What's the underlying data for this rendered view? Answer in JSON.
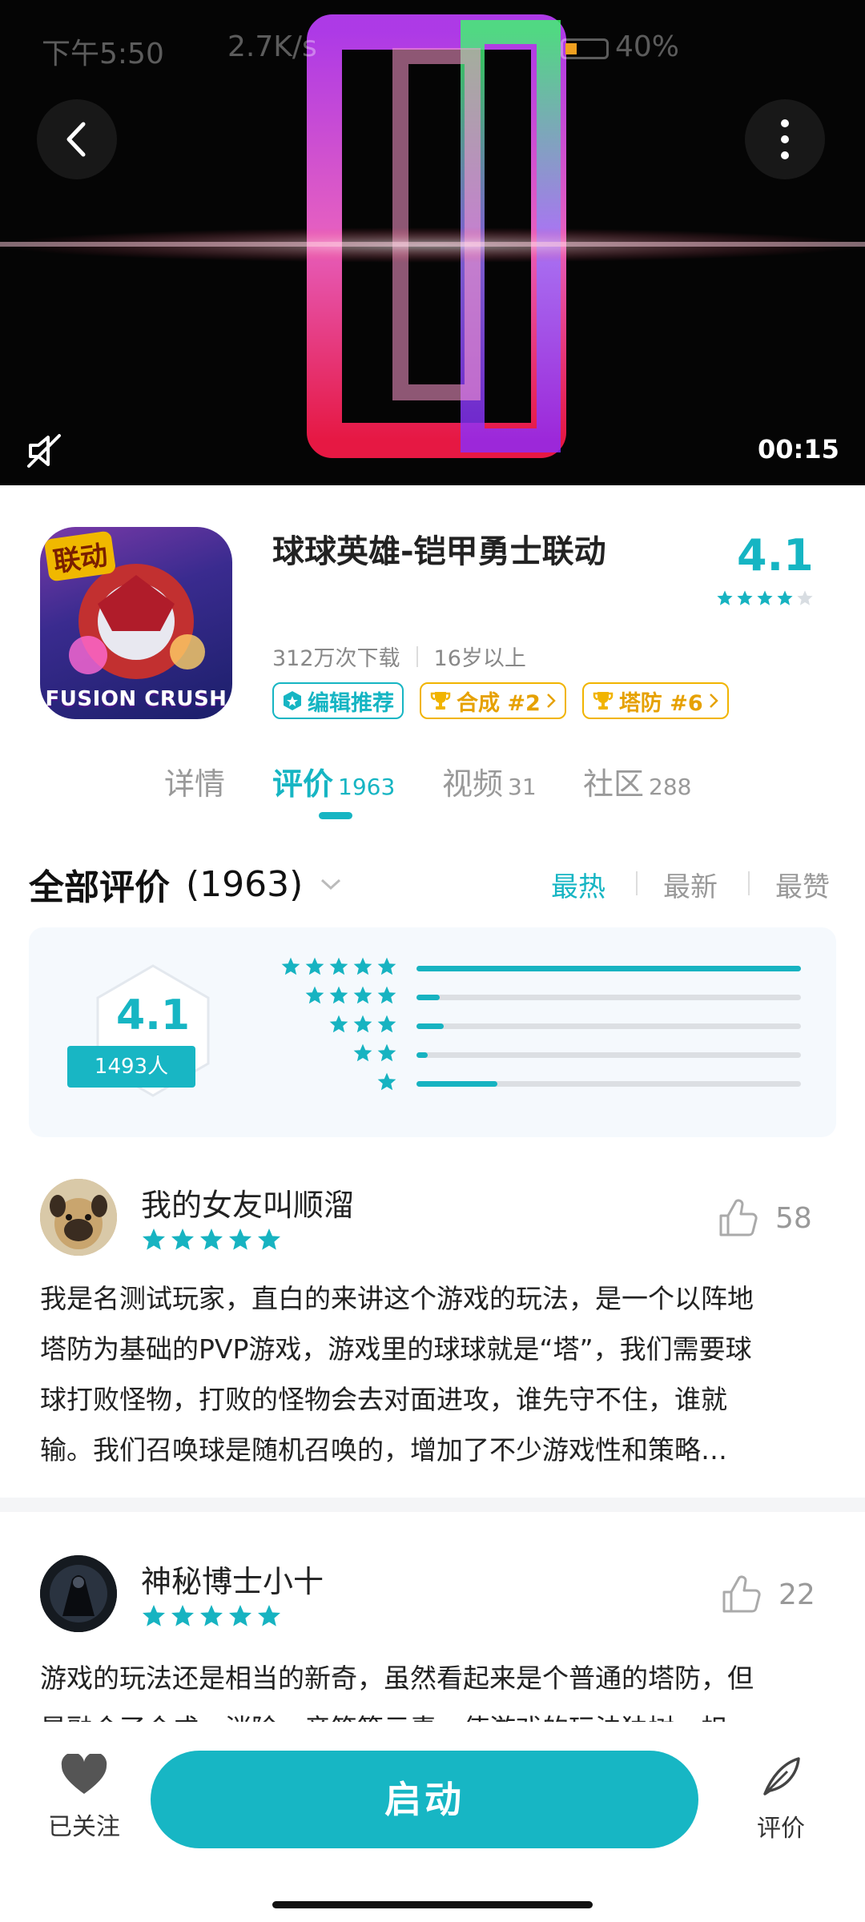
{
  "status_bar": {
    "time": "下午5:50",
    "speed": "2.7K/s",
    "battery": "40%"
  },
  "video": {
    "duration": "00:15",
    "back_icon": "back-arrow-icon",
    "more_icon": "more-vertical-icon",
    "mute_icon": "mute-icon"
  },
  "app": {
    "icon_badge": "联动",
    "icon_label": "FUSION CRUSH",
    "title": "球球英雄-铠甲勇士联动",
    "rating": "4.1",
    "downloads": "312万次下载",
    "age": "16岁以上",
    "tags": [
      {
        "label": "编辑推荐",
        "icon": "editor-badge-icon"
      },
      {
        "label": "合成 #2",
        "icon": "trophy-icon"
      },
      {
        "label": "塔防 #6",
        "icon": "trophy-icon"
      }
    ]
  },
  "tabs": [
    {
      "label": "详情",
      "count": ""
    },
    {
      "label": "评价",
      "count": "1963"
    },
    {
      "label": "视频",
      "count": "31"
    },
    {
      "label": "社区",
      "count": "288"
    }
  ],
  "reviews_header": {
    "title": "全部评价",
    "count": "(1963)",
    "sort": [
      "最热",
      "最新",
      "最赞"
    ],
    "active_sort": "最热"
  },
  "summary": {
    "score": "4.1",
    "people": "1493人",
    "distribution": [
      {
        "stars": 5,
        "fraction": 1.0
      },
      {
        "stars": 4,
        "fraction": 0.06
      },
      {
        "stars": 3,
        "fraction": 0.07
      },
      {
        "stars": 2,
        "fraction": 0.03
      },
      {
        "stars": 1,
        "fraction": 0.21
      }
    ]
  },
  "reviews": [
    {
      "user": "我的女友叫顺溜",
      "stars": 5,
      "likes": "58",
      "lines": [
        "我是名测试玩家，直白的来讲这个游戏的玩法，是一个以阵地",
        "塔防为基础的PVP游戏，游戏里的球球就是“塔”，我们需要球",
        "球打败怪物，打败的怪物会去对面进攻，谁先守不住，谁就",
        "输。我们召唤球是随机召唤的，增加了不少游戏性和策略…"
      ]
    },
    {
      "user": "神秘博士小十",
      "stars": 5,
      "likes": "22",
      "lines": [
        "游戏的玩法还是相当的新奇，虽然看起来是个普通的塔防，但",
        "是融合了合成，消除，音符等元素，使游戏的玩法独树一帜"
      ]
    }
  ],
  "bottom_bar": {
    "follow_label": "已关注",
    "launch_label": "启动",
    "rate_label": "评价"
  },
  "colors": {
    "accent": "#16b5c3",
    "gold": "#f1b400",
    "star": "#17b3c1"
  }
}
